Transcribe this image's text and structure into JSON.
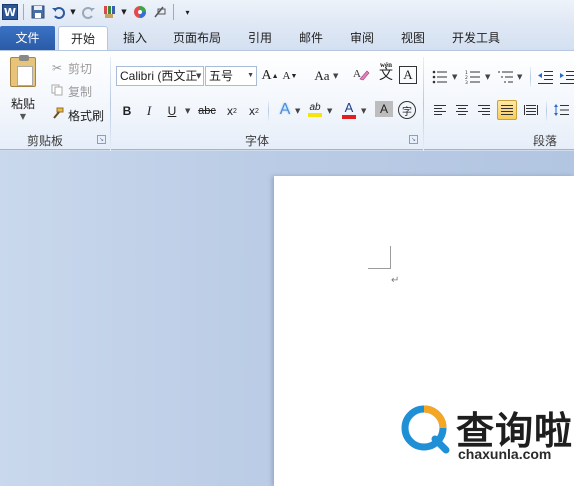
{
  "qat": {
    "app_logo": "W",
    "icons": [
      "word-icon",
      "save-icon",
      "undo-icon",
      "redo-icon",
      "format-painter-icon",
      "color-icon",
      "clear-icon",
      "customize-icon"
    ]
  },
  "tabs": {
    "file": "文件",
    "items": [
      "开始",
      "插入",
      "页面布局",
      "引用",
      "邮件",
      "审阅",
      "视图",
      "开发工具"
    ]
  },
  "clipboard": {
    "paste": "粘贴",
    "cut": "剪切",
    "copy": "复制",
    "format_painter": "格式刷",
    "group_label": "剪贴板"
  },
  "font": {
    "font_name": "Calibri (西文正",
    "font_size": "五号",
    "grow": "A",
    "shrink": "A",
    "change_case": "Aa",
    "bold": "B",
    "italic": "I",
    "underline": "U",
    "strike": "abc",
    "subscript": "x",
    "superscript": "x",
    "highlight": "ab",
    "font_color": "A",
    "char_shading": "A",
    "enclose": "字",
    "phonetic": "wén",
    "phonetic_char": "文",
    "char_border": "A",
    "group_label": "字体",
    "colors": {
      "font_color_bar": "#e02020",
      "highlight_bar": "#f5e50a",
      "text_effects": "#4a90d9"
    }
  },
  "paragraph": {
    "group_label": "段落"
  },
  "document": {
    "paragraph_mark": "↵"
  },
  "watermark": {
    "brand": "查询啦",
    "url": "chaxunla.com",
    "colors": {
      "ring": "#1f8fd6",
      "accent": "#f5a623"
    }
  }
}
